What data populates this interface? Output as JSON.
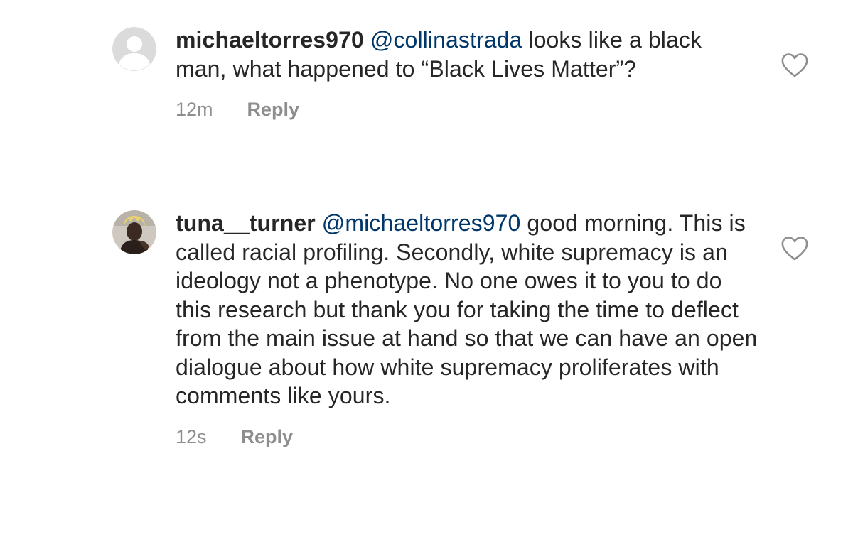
{
  "comments": [
    {
      "username": "michaeltorres970",
      "mention": "@collinastrada",
      "text": " looks like a black man, what happened to “Black Lives Matter”?",
      "time": "12m",
      "reply_label": "Reply",
      "avatar": "default-avatar-icon",
      "like_icon": "heart-outline-icon"
    },
    {
      "username": "tuna__turner",
      "mention": "@michaeltorres970",
      "text": " good morning. This is called racial profiling. Secondly, white supremacy is an ideology not a phenotype. No one owes it to you to do this research but thank you for taking the time to deflect from the main issue at hand so that we can have an open dialogue about how white supremacy proliferates with comments like yours.",
      "time": "12s",
      "reply_label": "Reply",
      "avatar": "user-photo-avatar",
      "like_icon": "heart-outline-icon"
    }
  ],
  "colors": {
    "text": "#262626",
    "mention": "#00376b",
    "meta": "#8e8e8e",
    "background": "#ffffff"
  }
}
